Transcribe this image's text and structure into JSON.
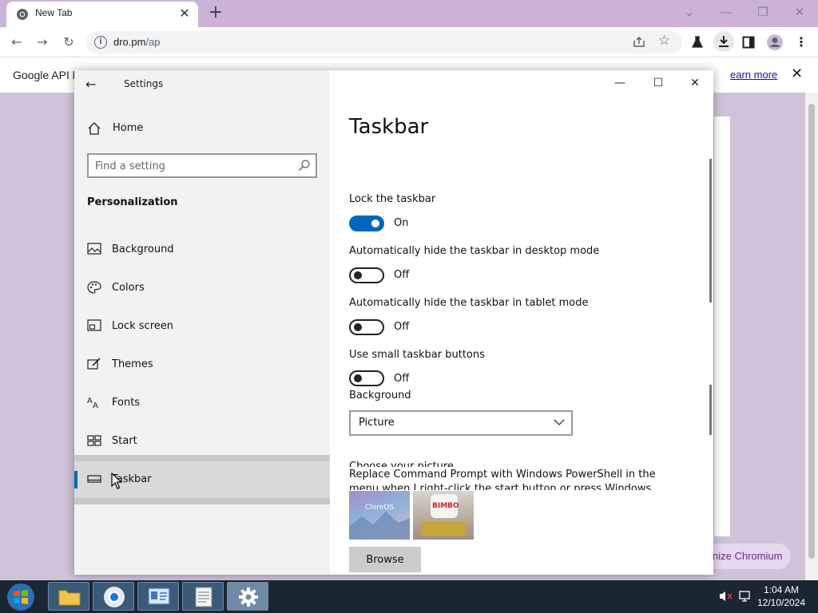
{
  "browser": {
    "tab_title": "New Tab",
    "new_tab_symbol": "+",
    "url_host": "dro.pm",
    "url_path": "/ap",
    "infobar_text": "Google API k",
    "infobar_link": "earn more",
    "customize_label": "nize Chromium"
  },
  "settings": {
    "app_title": "Settings",
    "home_label": "Home",
    "search_placeholder": "Find a setting",
    "section_title": "Personalization",
    "nav_items": [
      {
        "label": "Background",
        "icon": "image-icon"
      },
      {
        "label": "Colors",
        "icon": "palette-icon"
      },
      {
        "label": "Lock screen",
        "icon": "lock-screen-icon"
      },
      {
        "label": "Themes",
        "icon": "brush-icon"
      },
      {
        "label": "Fonts",
        "icon": "font-icon"
      },
      {
        "label": "Start",
        "icon": "start-grid-icon"
      },
      {
        "label": "Taskbar",
        "icon": "taskbar-icon",
        "selected": true
      }
    ],
    "page_title": "Taskbar",
    "options": [
      {
        "label": "Lock the taskbar",
        "state": "On",
        "on": true
      },
      {
        "label": "Automatically hide the taskbar in desktop mode",
        "state": "Off",
        "on": false
      },
      {
        "label": "Automatically hide the taskbar in tablet mode",
        "state": "Off",
        "on": false
      },
      {
        "label": "Use small taskbar buttons",
        "state": "Off",
        "on": false
      }
    ],
    "background_label": "Background",
    "background_value": "Picture",
    "choose_picture_label": "Choose your picture",
    "replace_text": "Replace Command Prompt with Windows PowerShell in the menu when I right-click the start button or press Windows key+X",
    "thumb1_text": "CloreOS",
    "thumb2_text": "BIMBO",
    "browse_label": "Browse"
  },
  "taskbar": {
    "time": "1:04 AM",
    "date": "12/10/2024"
  },
  "colors": {
    "accent": "#0067c0",
    "chrome_frame": "#cbb3d6",
    "taskbar": "#1b2633"
  }
}
